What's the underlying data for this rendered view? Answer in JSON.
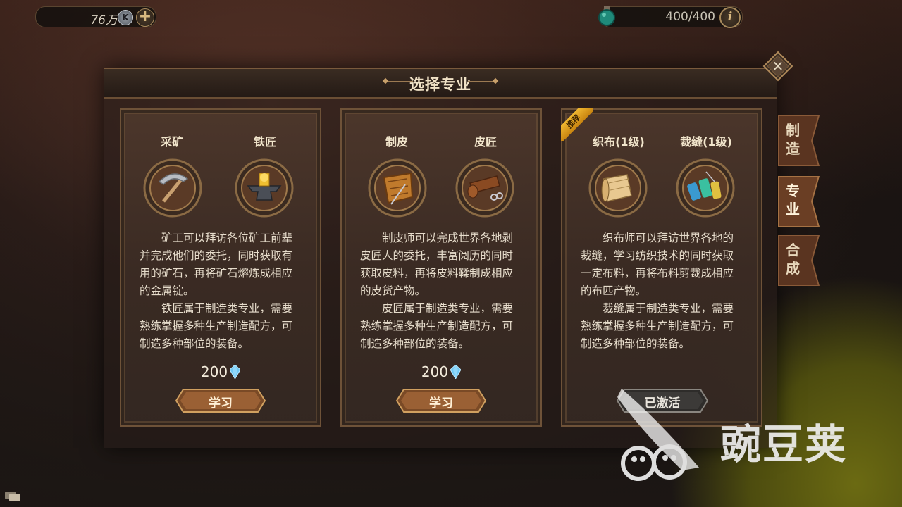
{
  "currency": {
    "amount": "76万",
    "icon_letter": "K",
    "add_symbol": "+"
  },
  "energy": {
    "amount": "400/400",
    "info_symbol": "i"
  },
  "panel": {
    "title": "选择专业",
    "close_symbol": "✕"
  },
  "side_tabs": [
    {
      "label": "制造",
      "active": false
    },
    {
      "label": "专业",
      "active": true
    },
    {
      "label": "合成",
      "active": false
    }
  ],
  "cards": [
    {
      "professions": [
        {
          "name": "采矿",
          "icon": "pickaxe-icon"
        },
        {
          "name": "铁匠",
          "icon": "anvil-icon"
        }
      ],
      "description": [
        "矿工可以拜访各位矿工前辈并完成他们的委托，同时获取有用的矿石，再将矿石熔炼成相应的金属锭。",
        "铁匠属于制造类专业，需要熟练掌握多种生产制造配方，可制造多种部位的装备。"
      ],
      "cost": "200",
      "cost_icon": "diamond-icon",
      "button": "学习"
    },
    {
      "professions": [
        {
          "name": "制皮",
          "icon": "leather-hide-icon"
        },
        {
          "name": "皮匠",
          "icon": "leather-roll-icon"
        }
      ],
      "description": [
        "制皮师可以完成世界各地剥皮匠人的委托，丰富阅历的同时获取皮料，再将皮料鞣制成相应的皮货产物。",
        "皮匠属于制造类专业，需要熟练掌握多种生产制造配方，可制造多种部位的装备。"
      ],
      "cost": "200",
      "cost_icon": "diamond-icon",
      "button": "学习"
    },
    {
      "badge": "推荐",
      "professions": [
        {
          "name": "织布(1级)",
          "icon": "cloth-bolt-icon"
        },
        {
          "name": "裁缝(1级)",
          "icon": "thread-spools-icon"
        }
      ],
      "description": [
        "织布师可以拜访世界各地的裁缝，学习纺织技术的同时获取一定布料，再将布料剪裁成相应的布匹产物。",
        "裁缝属于制造类专业，需要熟练掌握多种生产制造配方，可制造多种部位的装备。"
      ],
      "button": "已激活"
    }
  ],
  "watermark": {
    "text": "豌豆荚"
  },
  "colors": {
    "accent_gold": "#c8a06a",
    "panel_border": "#6e5238",
    "text_cream": "#e6dccb",
    "gem_blue": "#6ec8f4"
  }
}
